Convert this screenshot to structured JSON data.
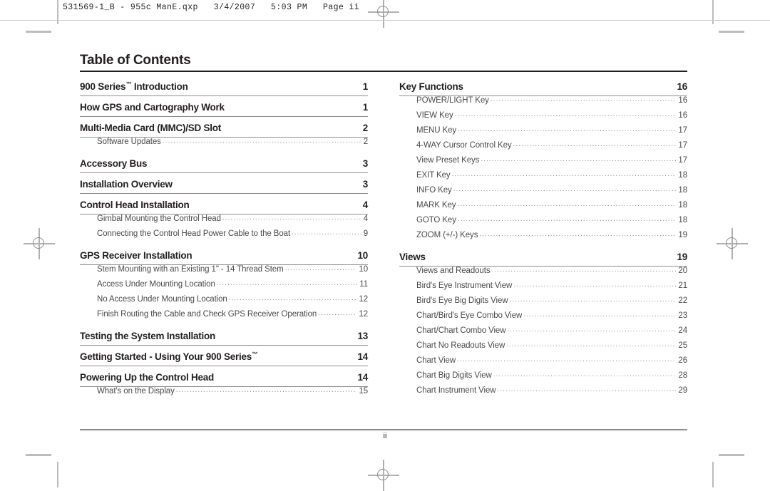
{
  "header": {
    "text": "531569-1_B - 955c ManE.qxp   3/4/2007   5:03 PM   Page ii"
  },
  "title": "Table of Contents",
  "footer": {
    "folio": "ii"
  },
  "columns": [
    {
      "name": "left-column",
      "blocks": [
        {
          "heading": {
            "label": "900 Series™ Introduction",
            "page": "1"
          },
          "items": []
        },
        {
          "heading": {
            "label": "How GPS and Cartography Work",
            "page": "1"
          },
          "items": []
        },
        {
          "heading": {
            "label": "Multi-Media Card (MMC)/SD Slot",
            "page": "2"
          },
          "items": [
            {
              "label": "Software Updates",
              "page": "2"
            }
          ]
        },
        {
          "heading": {
            "label": "Accessory Bus",
            "page": "3"
          },
          "items": []
        },
        {
          "heading": {
            "label": "Installation Overview",
            "page": "3"
          },
          "items": []
        },
        {
          "heading": {
            "label": "Control Head Installation",
            "page": "4"
          },
          "items": [
            {
              "label": "Gimbal Mounting the Control Head",
              "page": "4"
            },
            {
              "label": "Connecting the Control Head Power Cable to the Boat",
              "page": "9"
            }
          ]
        },
        {
          "heading": {
            "label": "GPS Receiver Installation",
            "page": "10"
          },
          "items": [
            {
              "label": "Stem Mounting with an Existing 1\" - 14 Thread Stem",
              "page": "10"
            },
            {
              "label": "Access Under Mounting Location",
              "page": "11"
            },
            {
              "label": "No Access Under Mounting Location",
              "page": "12"
            },
            {
              "label": "Finish Routing the Cable and Check GPS Receiver Operation",
              "page": "12"
            }
          ]
        },
        {
          "heading": {
            "label": "Testing the System Installation",
            "page": "13"
          },
          "items": []
        },
        {
          "heading": {
            "label": "Getting Started - Using Your 900 Series™",
            "page": "14"
          },
          "items": []
        },
        {
          "heading": {
            "label": "Powering Up the Control Head",
            "page": "14"
          },
          "items": [
            {
              "label": "What's on the Display",
              "page": "15"
            }
          ]
        }
      ]
    },
    {
      "name": "right-column",
      "blocks": [
        {
          "heading": {
            "label": "Key Functions",
            "page": "16"
          },
          "items": [
            {
              "label": "POWER/LIGHT Key",
              "page": "16"
            },
            {
              "label": "VIEW Key",
              "page": "16"
            },
            {
              "label": "MENU Key",
              "page": "17"
            },
            {
              "label": "4-WAY Cursor Control Key",
              "page": "17"
            },
            {
              "label": "View Preset Keys",
              "page": "17"
            },
            {
              "label": "EXIT Key",
              "page": "18"
            },
            {
              "label": "INFO Key",
              "page": "18"
            },
            {
              "label": "MARK Key",
              "page": "18"
            },
            {
              "label": "GOTO Key",
              "page": "18"
            },
            {
              "label": "ZOOM (+/-) Keys",
              "page": "19"
            }
          ]
        },
        {
          "heading": {
            "label": "Views",
            "page": "19"
          },
          "items": [
            {
              "label": "Views and Readouts",
              "page": "20"
            },
            {
              "label": "Bird's Eye Instrument View",
              "page": "21"
            },
            {
              "label": "Bird's Eye Big Digits View",
              "page": "22"
            },
            {
              "label": "Chart/Bird's Eye Combo View",
              "page": "23"
            },
            {
              "label": "Chart/Chart Combo View",
              "page": "24"
            },
            {
              "label": "Chart No Readouts View",
              "page": "25"
            },
            {
              "label": "Chart View",
              "page": "26"
            },
            {
              "label": "Chart Big Digits View",
              "page": "28"
            },
            {
              "label": "Chart Instrument View",
              "page": "29"
            }
          ]
        }
      ]
    }
  ]
}
